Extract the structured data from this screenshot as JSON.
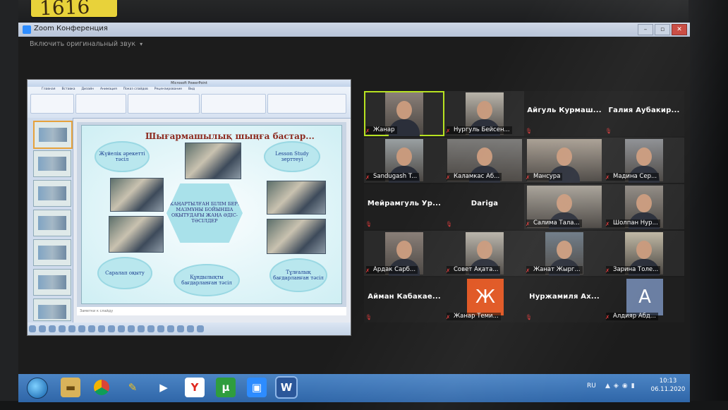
{
  "sticker": {
    "text": "1616"
  },
  "window": {
    "title": "Zoom Конференция",
    "buttons": [
      "–",
      "▫",
      "✕"
    ]
  },
  "toolbar": {
    "original_sound": "Включить оригинальный звук"
  },
  "slide": {
    "title": "Шығармашылық шыңға бастар...",
    "clouds": [
      "Жүйелік әрекетті тәсіл",
      "Lesson Study зерттеуі",
      "Саралап оқыту",
      "Құндылықты бағдарланған тәсіл",
      "Тұлғалық бағдарланған тәсіл"
    ],
    "center": "ЖАҢАРТЫЛҒАН БІЛІМ БЕРУ МАЗМҰНЫ БОЙЫНША ОҚЫТУДАҒЫ ЖАҢА ӘДІС-ТӘСІЛДЕР",
    "notes": "Заметки к слайду"
  },
  "participants": [
    {
      "name": "Жанар",
      "type": "video",
      "active": true
    },
    {
      "name": "Нургуль Бейсен...",
      "type": "video"
    },
    {
      "name": "Айгуль Курмаш...",
      "type": "name"
    },
    {
      "name": "Галия Аубакир...",
      "type": "name"
    },
    {
      "name": "Sandugash T...",
      "type": "video"
    },
    {
      "name": "Каламкас Аб...",
      "type": "video"
    },
    {
      "name": "Мансура",
      "type": "video"
    },
    {
      "name": "Мадина Сер...",
      "type": "video"
    },
    {
      "name": "Мейрамгуль Ур...",
      "type": "name"
    },
    {
      "name": "Dariga",
      "type": "name"
    },
    {
      "name": "Салима Тала...",
      "type": "video"
    },
    {
      "name": "Шолпан Нур...",
      "type": "video"
    },
    {
      "name": "Ардак Сарб...",
      "type": "video"
    },
    {
      "name": "Совет Ақата...",
      "type": "video"
    },
    {
      "name": "Жанат Жырг...",
      "type": "video"
    },
    {
      "name": "Зарина Толе...",
      "type": "video"
    },
    {
      "name": "Айман Кабакае...",
      "type": "name"
    },
    {
      "name": "Жанар Теми...",
      "type": "avatar",
      "letter": "Ж",
      "color": "#e0541f"
    },
    {
      "name": "Нуржамиля Ах...",
      "type": "name"
    },
    {
      "name": "Алдияр Абд...",
      "type": "avatar",
      "letter": "A",
      "color": "#6b7fa3"
    }
  ],
  "taskbar": {
    "lang": "RU",
    "time": "10:13",
    "date": "06.11.2020"
  }
}
